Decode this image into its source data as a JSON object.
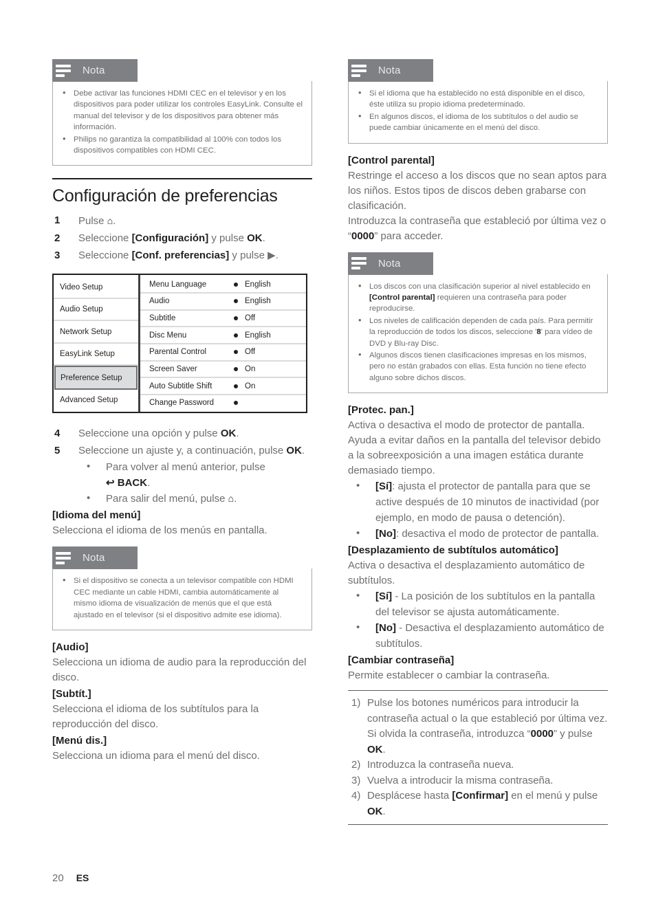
{
  "footer": {
    "page_number": "20",
    "language_code": "ES"
  },
  "notes_label": "Nota",
  "left_column": {
    "note_top": {
      "title": "Nota",
      "items": [
        "Debe activar las funciones HDMI CEC en el televisor y en los dispositivos para poder utilizar los controles EasyLink. Consulte el manual del televisor y de los dispositivos para obtener más información.",
        "Philips no garantiza la compatibilidad al 100% con todos los dispositivos compatibles con HDMI CEC."
      ]
    },
    "section_title": "Configuración de preferencias",
    "steps": [
      {
        "num": "1",
        "text_before": "Pulse ",
        "bold": "",
        "text_after": "⌂."
      },
      {
        "num": "2",
        "text_before": "Seleccione ",
        "bold": "[Configuración]",
        "text_after": " y pulse OK."
      },
      {
        "num": "3",
        "text_before": "Seleccione ",
        "bold": "[Conf. preferencias]",
        "text_after": " y pulse ▶."
      }
    ],
    "menu_figure": {
      "left_items": [
        "Video Setup",
        "Audio Setup",
        "Network Setup",
        "EasyLink Setup",
        "Preference Setup",
        "Advanced Setup"
      ],
      "selected_left_item": "Preference Setup",
      "options": [
        {
          "label": "Menu Language",
          "value": "English"
        },
        {
          "label": "Audio",
          "value": "English"
        },
        {
          "label": "Subtitle",
          "value": "Off"
        },
        {
          "label": "Disc Menu",
          "value": "English"
        },
        {
          "label": "Parental Control",
          "value": "Off"
        },
        {
          "label": "Screen Saver",
          "value": "On"
        },
        {
          "label": "Auto Subtitle Shift",
          "value": "On"
        },
        {
          "label": "Change Password",
          "value": ""
        }
      ]
    },
    "steps2": [
      {
        "num": "4",
        "text": "Seleccione una opción y pulse OK."
      },
      {
        "num": "5",
        "text": "Seleccione un ajuste y, a continuación, pulse OK."
      }
    ],
    "step5_bullets": [
      "Para volver al menú anterior, pulse ↶ BACK.",
      "Para salir del menú, pulse ⌂."
    ],
    "term_menu_language": "[Idioma del menú]",
    "desc_menu_language": "Selecciona el idioma de los menús en pantalla.",
    "note_bottom": {
      "title": "Nota",
      "items": [
        "Si el dispositivo se conecta a un televisor compatible con HDMI CEC mediante un cable HDMI, cambia automáticamente al mismo idioma de visualización de menús que el que está ajustado en el televisor (si el dispositivo admite ese idioma)."
      ]
    },
    "term_audio": "[Audio]",
    "desc_audio": "Selecciona un idioma de audio para la reproducción del disco.",
    "term_subtitle": "[Subtít.]",
    "desc_subtitle": "Selecciona el idioma de los subtítulos para la reproducción del disco.",
    "term_disc_menu": "[Menú dis.]",
    "desc_disc_menu": "Selecciona un idioma para el menú del disco."
  },
  "right_column": {
    "note_top": {
      "title": "Nota",
      "items": [
        "Si el idioma que ha establecido no está disponible en el disco, éste utiliza su propio idioma predeterminado.",
        "En algunos discos, el idioma de los subtítulos o del audio se puede cambiar únicamente en el menú del disco."
      ]
    },
    "term_parental": "[Control parental]",
    "desc_parental_1": "Restringe el acceso a los discos que no sean aptos para los niños. Estos tipos de discos deben grabarse con clasificación.",
    "desc_parental_2_before": "Introduzca la contraseña que estableció por última vez o “",
    "desc_parental_2_bold": "0000",
    "desc_parental_2_after": "” para acceder.",
    "note_parental": {
      "title": "Nota",
      "items": [
        {
          "before": "Los discos con una clasificación superior al nivel establecido en ",
          "bold": "[Control parental]",
          "after": " requieren una contraseña para poder reproducirse."
        },
        {
          "before": "Los niveles de calificación dependen de cada país. Para permitir la reproducción de todos los discos, seleccione '",
          "bold": "8",
          "after": "' para vídeo de DVD y Blu-ray Disc."
        },
        {
          "before": "Algunos discos tienen clasificaciones impresas en los mismos, pero no están grabados con ellas. Esta función no tiene efecto alguno sobre dichos discos.",
          "bold": "",
          "after": ""
        }
      ]
    },
    "term_screensaver": "[Protec. pan.]",
    "desc_screensaver": "Activa o desactiva el modo de protector de pantalla. Ayuda a evitar daños en la pantalla del televisor debido a la sobreexposición a una imagen estática durante demasiado tiempo.",
    "screensaver_options": [
      {
        "bold": "[Sí]",
        "text": ": ajusta el protector de pantalla para que se active después de 10 minutos de inactividad (por ejemplo, en modo de pausa o detención)."
      },
      {
        "bold": "[No]",
        "text": ": desactiva el modo de protector de pantalla."
      }
    ],
    "term_autoshift": "[Desplazamiento de subtítulos automático]",
    "desc_autoshift": "Activa o desactiva el desplazamiento automático de subtítulos.",
    "autoshift_options": [
      {
        "bold": "[Sí]",
        "text": " - La posición de los subtítulos en la pantalla del televisor se ajusta automáticamente."
      },
      {
        "bold": "[No]",
        "text": " - Desactiva el desplazamiento automático de subtítulos."
      }
    ],
    "term_change_password": "[Cambiar contraseña]",
    "desc_change_password": "Permite establecer o cambiar la contraseña.",
    "procedure": [
      {
        "num": "1)",
        "parts": [
          {
            "t": "Pulse los botones numéricos para introducir la contraseña actual o la que estableció por última vez. Si olvida la contraseña, introduzca “",
            "b": false
          },
          {
            "t": "0000",
            "b": true
          },
          {
            "t": "” y pulse ",
            "b": false
          },
          {
            "t": "OK",
            "b": true
          },
          {
            "t": ".",
            "b": false
          }
        ]
      },
      {
        "num": "2)",
        "parts": [
          {
            "t": "Introduzca la contraseña nueva.",
            "b": false
          }
        ]
      },
      {
        "num": "3)",
        "parts": [
          {
            "t": "Vuelva a introducir la misma contraseña.",
            "b": false
          }
        ]
      },
      {
        "num": "4)",
        "parts": [
          {
            "t": "Desplácese hasta ",
            "b": false
          },
          {
            "t": "[Confirmar]",
            "b": true
          },
          {
            "t": " en el menú y pulse ",
            "b": false
          },
          {
            "t": "OK",
            "b": true
          },
          {
            "t": ".",
            "b": false
          }
        ]
      }
    ]
  }
}
